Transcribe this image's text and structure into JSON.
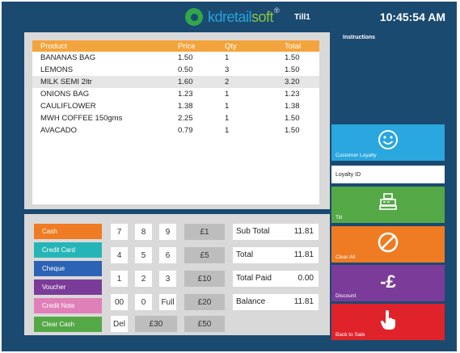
{
  "header": {
    "logo_part1": "k",
    "logo_part2": "dretail",
    "logo_part3": "soft",
    "logo_reg": "®",
    "till": "Till1",
    "time": "10:45:54 AM"
  },
  "receipt": {
    "columns": [
      "Product",
      "Price",
      "Qty",
      "Total"
    ],
    "rows": [
      {
        "product": "BANANAS BAG",
        "price": "1.50",
        "qty": "1",
        "total": "1.50"
      },
      {
        "product": "LEMONS",
        "price": "0.50",
        "qty": "3",
        "total": "1.50"
      },
      {
        "product": "MILK SEMI 2ltr",
        "price": "1.60",
        "qty": "2",
        "total": "3.20"
      },
      {
        "product": "ONIONS BAG",
        "price": "1.23",
        "qty": "1",
        "total": "1.23"
      },
      {
        "product": "CAULIFLOWER",
        "price": "1.38",
        "qty": "1",
        "total": "1.38"
      },
      {
        "product": "MWH COFFEE 150gms",
        "price": "2.25",
        "qty": "1",
        "total": "1.50"
      },
      {
        "product": "AVACADO",
        "price": "0.79",
        "qty": "1",
        "total": "1.50"
      }
    ]
  },
  "payment_methods": [
    {
      "label": "Cash",
      "color": "#ef7b22"
    },
    {
      "label": "Credit Card",
      "color": "#26b5b7"
    },
    {
      "label": "Cheque",
      "color": "#2d63b4"
    },
    {
      "label": "Voucher",
      "color": "#7b3c99"
    },
    {
      "label": "Credit Note",
      "color": "#e080b8"
    },
    {
      "label": "Clear Cash",
      "color": "#55a846"
    }
  ],
  "keypad": {
    "k7": "7",
    "k8": "8",
    "k9": "9",
    "k4": "4",
    "k5": "5",
    "k6": "6",
    "k1": "1",
    "k2": "2",
    "k3": "3",
    "k00": "00",
    "k0": "0",
    "full": "Full",
    "del": "Del"
  },
  "notes": {
    "n1": "£1",
    "n5": "£5",
    "n10": "£10",
    "n20": "£20",
    "n30": "£30",
    "n50": "£50"
  },
  "summary": {
    "subtotal_label": "Sub Total",
    "subtotal": "11.81",
    "total_label": "Total",
    "total": "11.81",
    "paid_label": "Total Paid",
    "paid": "0.00",
    "balance_label": "Balance",
    "balance": "11.81"
  },
  "side": {
    "instructions": "Instructions",
    "customer_loyalty": "Customer Loyalty",
    "loyalty_id": "Loyalty ID",
    "till": "Till",
    "clear_all": "Clear All",
    "discount": "Discount",
    "back_to_sale": "Back to Sale",
    "colors": {
      "loyalty": "#29a7de",
      "till": "#55a846",
      "clear": "#ef7b22",
      "discount": "#7b3c99",
      "back": "#e0232a"
    }
  },
  "icons": [
    "smiley-icon",
    "cash-register-icon",
    "no-entry-icon",
    "minus-pound-icon",
    "hand-pointer-icon"
  ]
}
